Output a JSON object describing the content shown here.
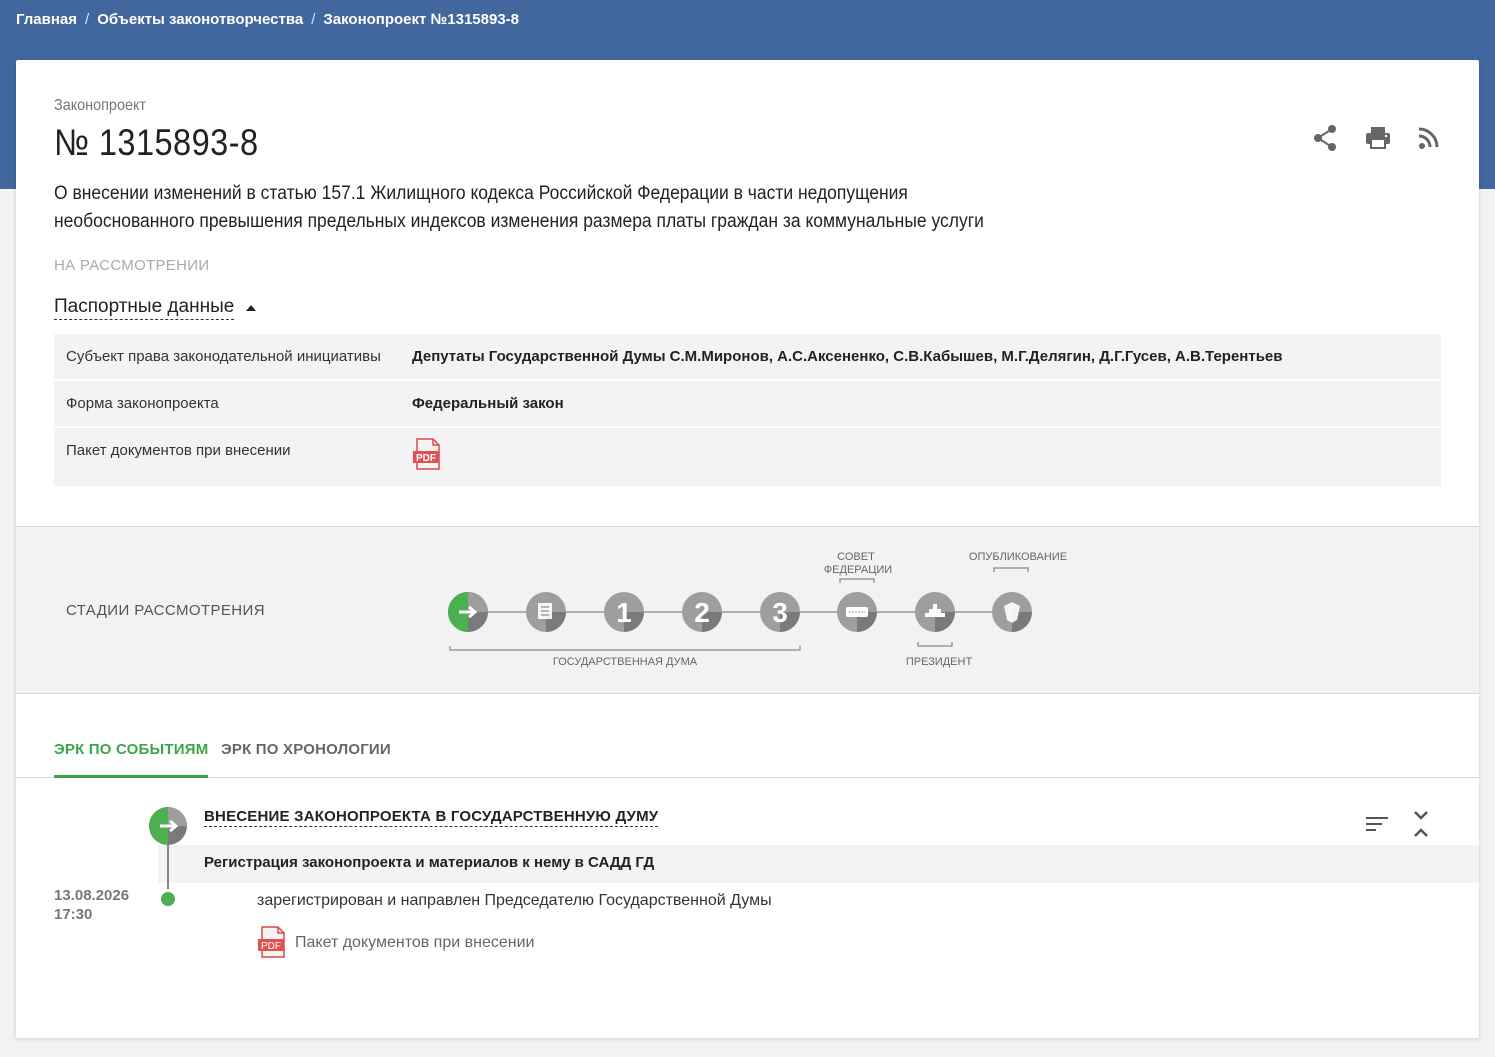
{
  "breadcrumb": {
    "home": "Главная",
    "objects": "Объекты законотворчества",
    "current": "Законопроект №1315893-8",
    "separator": "/"
  },
  "bill": {
    "kicker": "Законопроект",
    "number": "№ 1315893-8",
    "description": "О внесении изменений в статью 157.1 Жилищного кодекса Российской Федерации в части недопущения необоснованного превышения предельных индексов изменения размера платы граждан за коммунальные услуги",
    "status": "НА РАССМОТРЕНИИ"
  },
  "actions": {
    "share_icon": "share-icon",
    "print_icon": "print-icon",
    "rss_icon": "rss-icon"
  },
  "passport": {
    "toggle_label": "Паспортные данные",
    "rows": [
      {
        "key": "Субъект права законодательной инициативы",
        "value": "Депутаты Государственной Думы С.М.Миронов, А.С.Аксененко, С.В.Кабышев, М.Г.Делягин, Д.Г.Гусев, А.В.Терентьев"
      },
      {
        "key": "Форма законопроекта",
        "value": "Федеральный закон"
      },
      {
        "key": "Пакет документов при внесении",
        "value": ""
      }
    ],
    "pdf_label": "PDF"
  },
  "stages": {
    "title": "СТАДИИ РАССМОТРЕНИЯ",
    "duma_label": "ГОСУДАРСТВЕННАЯ ДУМА",
    "sovfed_label_1": "СОВЕТ",
    "sovfed_label_2": "ФЕДЕРАЦИИ",
    "president_label": "ПРЕЗИДЕНТ",
    "publish_label": "ОПУБЛИКОВАНИЕ",
    "reading_1": "1",
    "reading_2": "2",
    "reading_3": "3",
    "active_stage_index": 0,
    "colors": {
      "active": "#4caf50",
      "inactive": "#9e9e9e",
      "dark": "#7a7a7a"
    }
  },
  "tabs": {
    "events": "ЭРК ПО СОБЫТИЯМ",
    "chronology": "ЭРК ПО ХРОНОЛОГИИ"
  },
  "event": {
    "title": "ВНЕСЕНИЕ ЗАКОНОПРОЕКТА В ГОСУДАРСТВЕННУЮ ДУМУ",
    "subtitle": "Регистрация законопроекта и материалов к нему в САДД ГД",
    "date": "13.08.2026",
    "time": "17:30",
    "text": "зарегистрирован и направлен Председателю Государственной Думы",
    "doc_label": "Пакет документов при внесении",
    "pdf_label": "PDF"
  }
}
